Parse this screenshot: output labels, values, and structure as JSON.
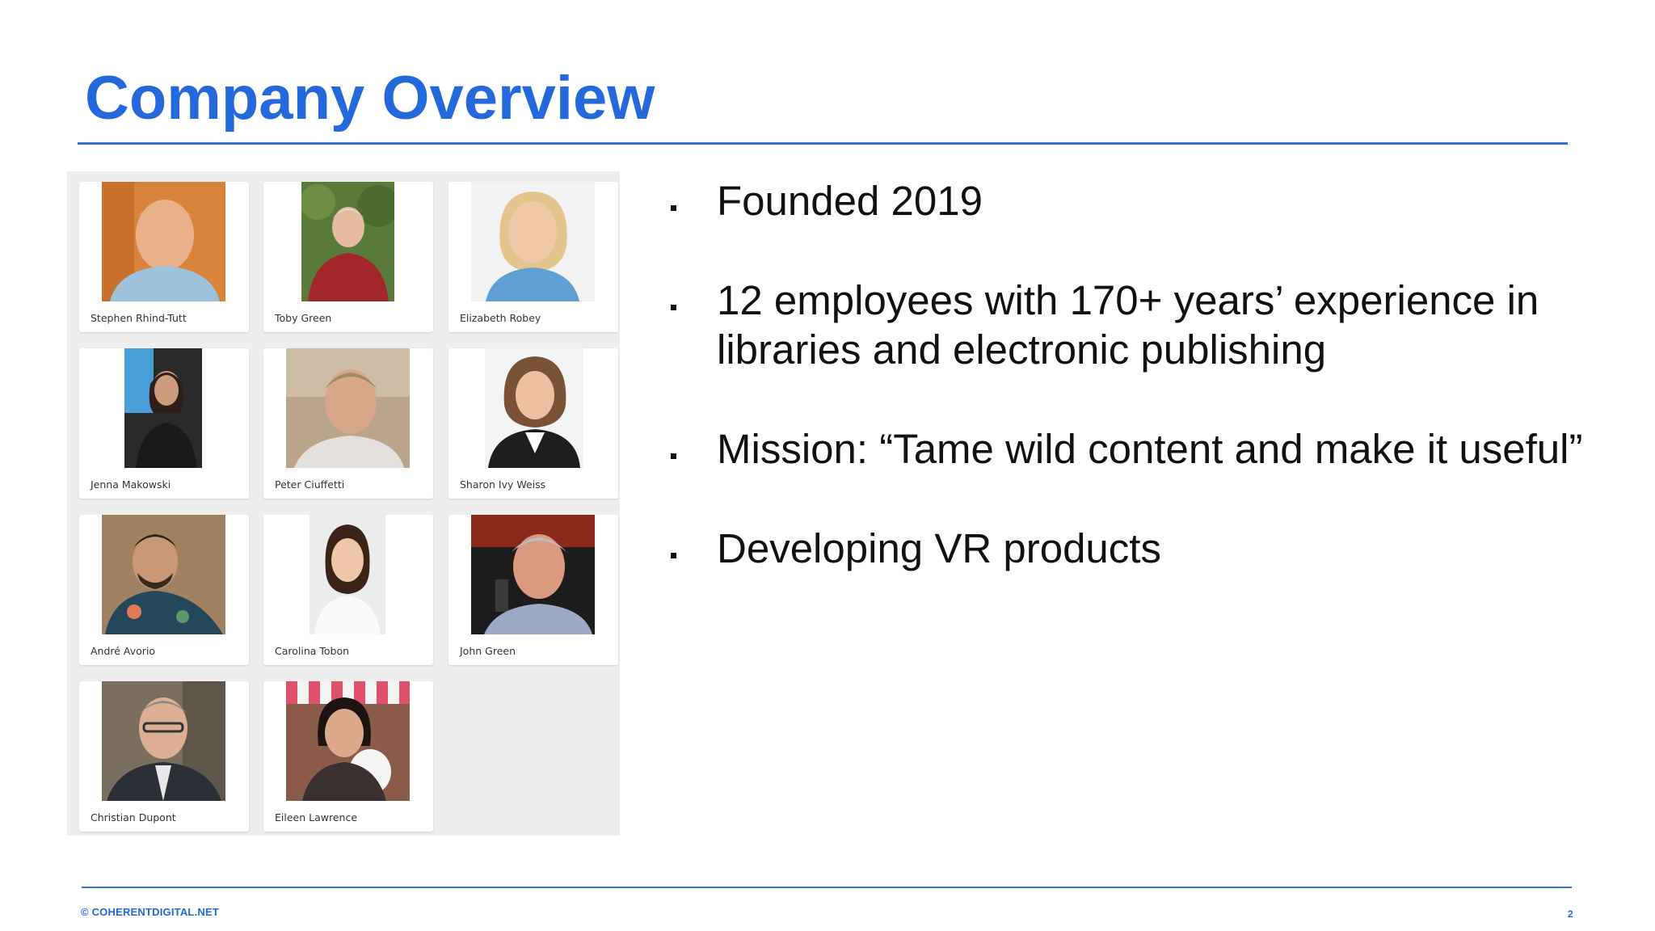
{
  "slide": {
    "title": "Company Overview",
    "footer": "© COHERENTDIGITAL.NET",
    "page_number": "2"
  },
  "team": [
    {
      "name": "Stephen Rhind-Tutt"
    },
    {
      "name": "Toby Green"
    },
    {
      "name": "Elizabeth Robey"
    },
    {
      "name": "Jenna Makowski"
    },
    {
      "name": "Peter Ciuffetti"
    },
    {
      "name": "Sharon Ivy Weiss"
    },
    {
      "name": "André Avorio"
    },
    {
      "name": "Carolina Tobon"
    },
    {
      "name": "John Green"
    },
    {
      "name": "Christian Dupont"
    },
    {
      "name": "Eileen Lawrence"
    }
  ],
  "bullets": [
    {
      "text": "Founded 2019"
    },
    {
      "text": "12 employees with 170+ years’ experience in libraries and electronic publishing"
    },
    {
      "text": "Mission:  “Tame wild content and make it useful”"
    },
    {
      "text": "Developing VR products"
    }
  ],
  "colors": {
    "accent": "#2469dc",
    "rule": "#3b6fd8",
    "panel": "#eeeeef"
  }
}
